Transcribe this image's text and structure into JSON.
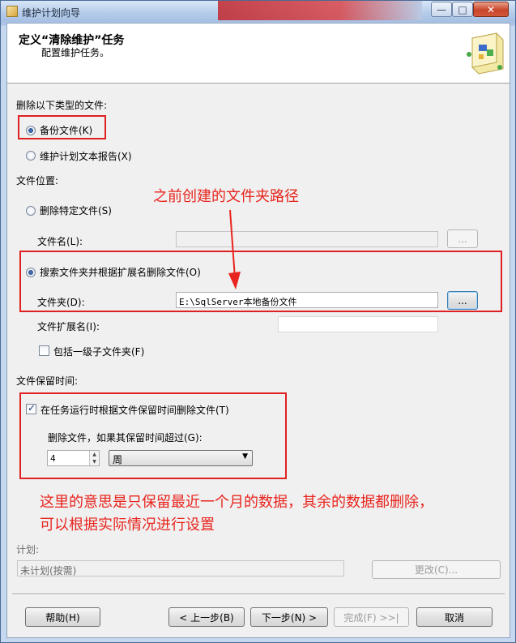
{
  "window": {
    "title": "维护计划向导"
  },
  "header": {
    "title": "定义“清除维护”任务",
    "subtitle": "配置维护任务。"
  },
  "file_type": {
    "label": "删除以下类型的文件:",
    "backup_files": "备份文件(K)",
    "report_files": "维护计划文本报告(X)"
  },
  "location": {
    "label": "文件位置:",
    "delete_specific": "删除特定文件(S)",
    "filename_label": "文件名(L):",
    "filename_browse": "...",
    "search_folder": "搜索文件夹并根据扩展名删除文件(O)",
    "folder_label": "文件夹(D):",
    "folder_value": "E:\\SqlServer本地备份文件",
    "folder_browse": "...",
    "extension_label": "文件扩展名(I):",
    "extension_value": "",
    "include_subfolders": "包括一级子文件夹(F)"
  },
  "retention": {
    "label": "文件保留时间:",
    "checkbox_label": "在任务运行时根据文件保留时间删除文件(T)",
    "older_than_label": "删除文件，如果其保留时间超过(G):",
    "amount": "4",
    "unit": "周"
  },
  "schedule": {
    "label": "计划:",
    "value": "未计划(按需)",
    "change_button": "更改(C)..."
  },
  "annotations": {
    "folder_note": "之前创建的文件夹路径",
    "retention_note_1": "这里的意思是只保留最近一个月的数据，其余的数据都删除，",
    "retention_note_2": "可以根据实际情况进行设置",
    "color": "#e8251e"
  },
  "footer": {
    "help": "帮助(H)",
    "back": "< 上一步(B)",
    "next": "下一步(N) >",
    "finish": "完成(F) >>|",
    "cancel": "取消"
  }
}
